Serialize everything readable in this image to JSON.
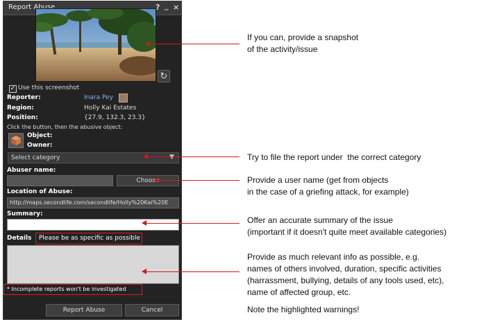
{
  "window": {
    "title": "Report Abuse",
    "help_glyph": "?",
    "minimize_glyph": "_",
    "close_glyph": "×"
  },
  "snapshot": {
    "use_screenshot_label": "Use this screenshot",
    "checked_glyph": "✓",
    "refresh_glyph": "↻"
  },
  "info": {
    "reporter_label": "Reporter:",
    "reporter_value": "Inara Pey",
    "region_label": "Region:",
    "region_value": "Holly Kai Estates",
    "position_label": "Position:",
    "position_value": "{27.9, 132.3, 23.3}",
    "instruction": "Click the button, then the abusive object:",
    "object_label": "Object:",
    "owner_label": "Owner:"
  },
  "category": {
    "selected": "Select category",
    "arrow_glyph": "▼"
  },
  "abuser": {
    "label": "Abuser name:",
    "choose_label": "Choose"
  },
  "location": {
    "label": "Location of Abuse:",
    "value": "http://maps.secondlife.com/secondlife/Holly%20Kai%20E"
  },
  "summary": {
    "label": "Summary:"
  },
  "details": {
    "label": "Details",
    "hint": "Please be as specific as possible"
  },
  "warning": "* Incomplete reports won't be investigated",
  "buttons": {
    "report": "Report Abuse",
    "cancel": "Cancel"
  },
  "annotations": {
    "snapshot_1": "If you can, provide a snapshot",
    "snapshot_2": "of the activity/issue",
    "category": "Try to file the report under  the correct category",
    "username_1": "Provide a user name (get from objects",
    "username_2": "in the case of a griefing attack, for example)",
    "summary_1": "Offer an accurate summary of the issue",
    "summary_2": "(important if it doesn't quite meet available categories)",
    "details_1": "Provide as much relevant info as possible, e.g.",
    "details_2": "names of others involved, duration, specific activities",
    "details_3": "(harrassment, bullying, details of any tools used, etc),",
    "details_4": "name of affected group, etc.",
    "warnings": "Note the highlighted warnings!"
  },
  "colors": {
    "panel_bg": "#232323",
    "annotation_red": "#cc1a1a",
    "link_blue": "#8db2e6"
  }
}
